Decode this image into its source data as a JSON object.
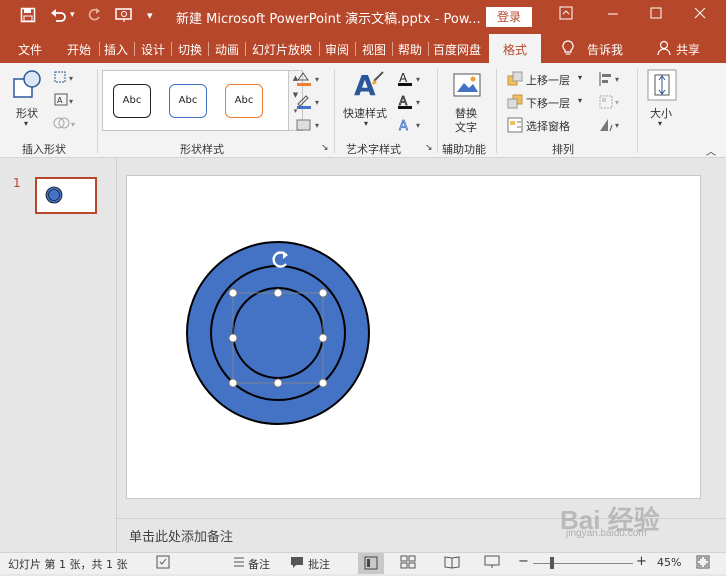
{
  "titlebar": {
    "title": "新建 Microsoft PowerPoint 演示文稿.pptx  -  Pow...",
    "login_label": "登录",
    "icons": [
      "save-icon",
      "undo-icon",
      "redo-icon",
      "present-from-start-icon",
      "customize-qat-icon",
      "ribbon-display-options-icon",
      "minimize-icon",
      "maximize-icon",
      "close-icon"
    ]
  },
  "tabs": [
    {
      "label": "文件"
    },
    {
      "label": "开始"
    },
    {
      "label": "插入"
    },
    {
      "label": "设计"
    },
    {
      "label": "切换"
    },
    {
      "label": "动画"
    },
    {
      "label": "幻灯片放映"
    },
    {
      "label": "审阅"
    },
    {
      "label": "视图"
    },
    {
      "label": "帮助"
    },
    {
      "label": "百度网盘"
    },
    {
      "label": "格式"
    }
  ],
  "tell_me": "告诉我",
  "share": "共享",
  "ribbon": {
    "insert_shapes": {
      "shape_label": "形状",
      "group_label": "插入形状"
    },
    "shape_styles": {
      "abc": [
        "Abc",
        "Abc",
        "Abc"
      ],
      "group_label": "形状样式"
    },
    "wordart": {
      "quick_styles_label": "快速样式",
      "group_label": "艺术字样式"
    },
    "accessibility": {
      "alt_text_label_1": "替换",
      "alt_text_label_2": "文字",
      "group_label": "辅助功能"
    },
    "arrange": {
      "bring_forward": "上移一层",
      "send_backward": "下移一层",
      "selection_pane": "选择窗格",
      "group_label": "排列"
    },
    "size": {
      "size_label": "大小"
    }
  },
  "thumbs": {
    "slide_number": "1"
  },
  "notes_placeholder": "单击此处添加备注",
  "statusbar": {
    "slide_info": "幻灯片 第 1 张，共 1 张",
    "notes_label": "备注",
    "comments_label": "批注",
    "zoom_percent": "45%",
    "zoom_minus": "−",
    "zoom_plus": "+"
  },
  "watermark": {
    "text": "Bai 经验",
    "sub": "jingyan.baidu.com"
  },
  "colors": {
    "accent": "#b7472a",
    "shape_fill": "#4472c4"
  }
}
